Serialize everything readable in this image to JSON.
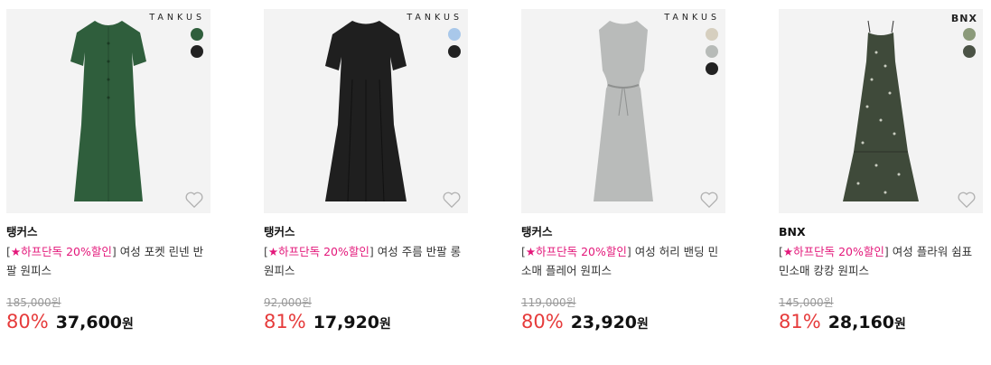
{
  "products": [
    {
      "logo": "TANKUS",
      "brand": "탱커스",
      "promo_open": "[",
      "promo": "★하프단독 20%할인",
      "promo_close": "]",
      "name": " 여성 포켓 린넨 반팔 원피스",
      "original_price": "185,000원",
      "discount_rate": "80%",
      "sale_price": "37,600",
      "currency": "원",
      "dress_color": "#2f5e3c",
      "swatches": [
        "#2f5e3c",
        "#222222"
      ]
    },
    {
      "logo": "TANKUS",
      "brand": "탱커스",
      "promo_open": "[",
      "promo": "★하프단독 20%할인",
      "promo_close": "]",
      "name": " 여성 주름 반팔 롱 원피스",
      "original_price": "92,000원",
      "discount_rate": "81%",
      "sale_price": "17,920",
      "currency": "원",
      "dress_color": "#1f1f1f",
      "swatches": [
        "#a9c8ea",
        "#222222"
      ]
    },
    {
      "logo": "TANKUS",
      "brand": "탱커스",
      "promo_open": "[",
      "promo": "★하프단독 20%할인",
      "promo_close": "]",
      "name": " 여성 허리 밴딩 민소매 플레어 원피스",
      "original_price": "119,000원",
      "discount_rate": "80%",
      "sale_price": "23,920",
      "currency": "원",
      "dress_color": "#b9bbba",
      "swatches": [
        "#d6cfbf",
        "#b7bbb8",
        "#222222"
      ]
    },
    {
      "logo": "BNX",
      "brand": "BNX",
      "promo_open": "[",
      "promo": "★하프단독 20%할인",
      "promo_close": "]",
      "name": " 여성 플라워 쉼표 민소매 캉캉 원피스",
      "original_price": "145,000원",
      "discount_rate": "81%",
      "sale_price": "28,160",
      "currency": "원",
      "dress_color": "#3f4a3a",
      "swatches": [
        "#8b9a7a",
        "#4a5245"
      ]
    }
  ],
  "icons": {
    "wishlist": "heart-outline-icon"
  },
  "colors": {
    "accent_pink": "#e3177a",
    "discount_red": "#e63b3b"
  }
}
